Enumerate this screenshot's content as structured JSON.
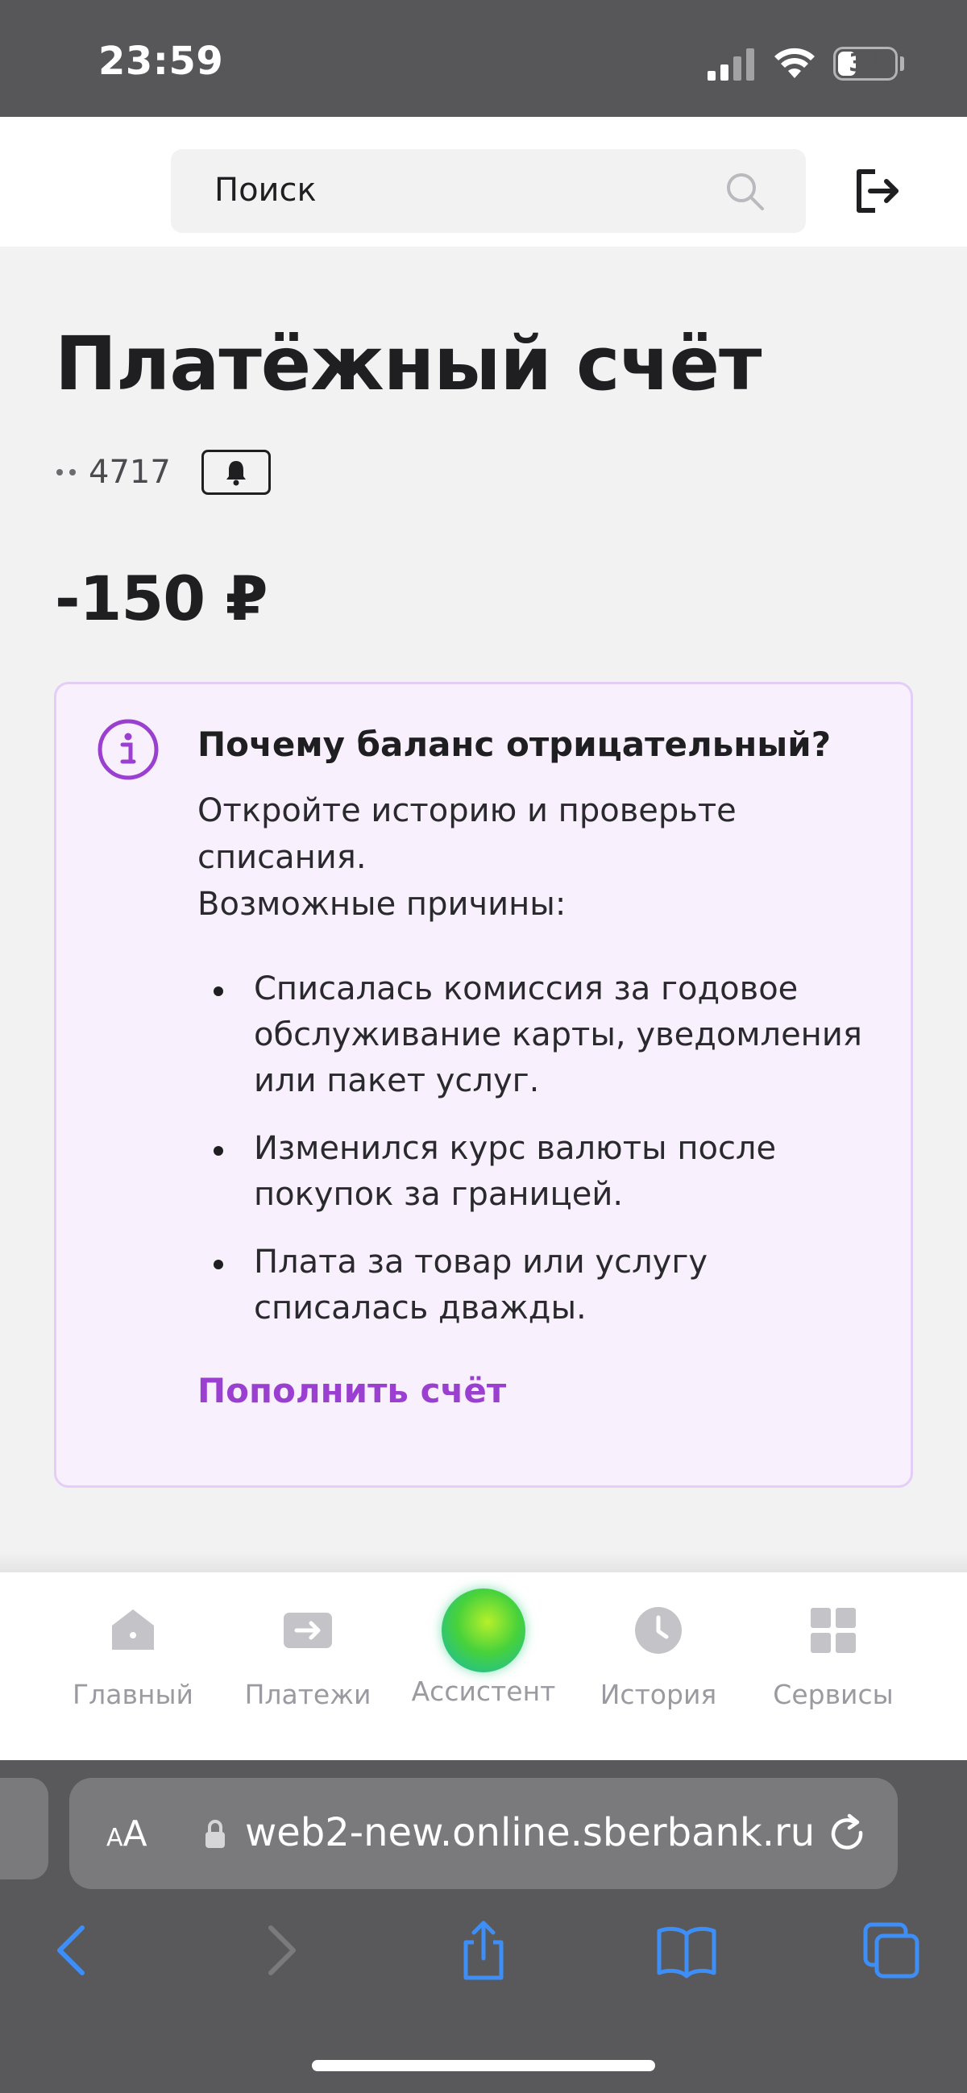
{
  "status_bar": {
    "time": "23:59",
    "battery_level": "31"
  },
  "header": {
    "search_placeholder": "Поиск"
  },
  "account": {
    "title": "Платёжный счёт",
    "number_masked": "4717",
    "balance": "-150 ₽"
  },
  "info_card": {
    "title": "Почему баланс отрицательный?",
    "text_line1": "Откройте историю и проверьте списания.",
    "text_line2": "Возможные причины:",
    "reasons": [
      "Списалась комиссия за годовое обслуживание карты, уведомления или пакет услуг.",
      "Изменился курс валюты после покупок за границей.",
      "Плата за товар или услугу списалась дважды."
    ],
    "action_label": "Пополнить счёт",
    "accent_color": "#9b3fd1"
  },
  "tabbar": {
    "items": [
      {
        "label": "Главный",
        "icon": "home-icon"
      },
      {
        "label": "Платежи",
        "icon": "payments-icon"
      },
      {
        "label": "Ассистент",
        "icon": "assistant-orb-icon"
      },
      {
        "label": "История",
        "icon": "clock-icon"
      },
      {
        "label": "Сервисы",
        "icon": "grid-icon"
      }
    ]
  },
  "browser": {
    "aa_label": "AA",
    "url": "web2-new.online.sberbank.ru"
  }
}
